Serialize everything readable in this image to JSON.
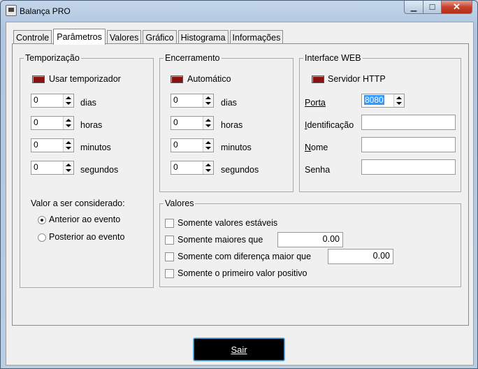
{
  "window": {
    "title": "Balança PRO"
  },
  "tabs": [
    {
      "label": "Controle"
    },
    {
      "label": "Parâmetros"
    },
    {
      "label": "Valores"
    },
    {
      "label": "Gráfico"
    },
    {
      "label": "Histograma"
    },
    {
      "label": "Informações"
    }
  ],
  "temporizacao": {
    "title": "Temporização",
    "toggle_label": "Usar temporizador",
    "fields": [
      {
        "value": "0",
        "unit": "dias"
      },
      {
        "value": "0",
        "unit": "horas"
      },
      {
        "value": "0",
        "unit": "minutos"
      },
      {
        "value": "0",
        "unit": "segundos"
      }
    ],
    "valor_label": "Valor a ser considerado:",
    "options": [
      {
        "label": "Anterior ao evento",
        "selected": true
      },
      {
        "label": "Posterior ao evento",
        "selected": false
      }
    ]
  },
  "encerramento": {
    "title": "Encerramento",
    "toggle_label": "Automático",
    "fields": [
      {
        "value": "0",
        "unit": "dias"
      },
      {
        "value": "0",
        "unit": "horas"
      },
      {
        "value": "0",
        "unit": "minutos"
      },
      {
        "value": "0",
        "unit": "segundos"
      }
    ]
  },
  "web": {
    "title": "Interface WEB",
    "toggle_label": "Servidor HTTP",
    "porta_label": "Porta",
    "porta_value": "8080",
    "ident_label": "Identificação",
    "ident_value": "",
    "nome_label": "Nome",
    "nome_value": "",
    "senha_label": "Senha",
    "senha_value": ""
  },
  "valores": {
    "title": "Valores",
    "estaveis_label": "Somente valores estáveis",
    "maiores_label": "Somente maiores que",
    "maiores_value": "0.00",
    "diferenca_label": "Somente com diferença maior que",
    "diferenca_value": "0.00",
    "positivo_label": "Somente o primeiro valor positivo"
  },
  "sair_label": "Sair",
  "colors": {
    "led": "#8b1010",
    "selection": "#3399ff"
  }
}
